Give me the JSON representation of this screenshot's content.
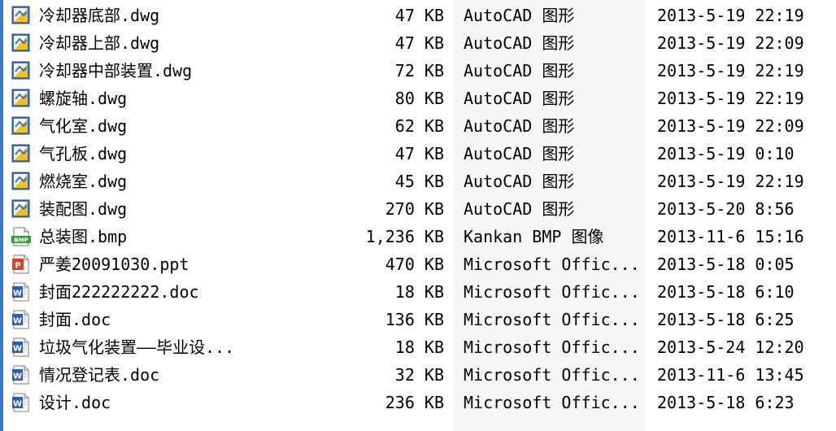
{
  "files": [
    {
      "name": "冷却器底部.dwg",
      "size": "47 KB",
      "type": "AutoCAD 图形",
      "date": "2013-5-19 22:19",
      "icon": "dwg-file-icon"
    },
    {
      "name": "冷却器上部.dwg",
      "size": "47 KB",
      "type": "AutoCAD 图形",
      "date": "2013-5-19 22:09",
      "icon": "dwg-file-icon"
    },
    {
      "name": "冷却器中部装置.dwg",
      "size": "72 KB",
      "type": "AutoCAD 图形",
      "date": "2013-5-19 22:19",
      "icon": "dwg-file-icon"
    },
    {
      "name": "螺旋轴.dwg",
      "size": "80 KB",
      "type": "AutoCAD 图形",
      "date": "2013-5-19 22:19",
      "icon": "dwg-file-icon"
    },
    {
      "name": "气化室.dwg",
      "size": "62 KB",
      "type": "AutoCAD 图形",
      "date": "2013-5-19 22:09",
      "icon": "dwg-file-icon"
    },
    {
      "name": "气孔板.dwg",
      "size": "47 KB",
      "type": "AutoCAD 图形",
      "date": "2013-5-19 0:10",
      "icon": "dwg-file-icon"
    },
    {
      "name": "燃烧室.dwg",
      "size": "45 KB",
      "type": "AutoCAD 图形",
      "date": "2013-5-19 22:19",
      "icon": "dwg-file-icon"
    },
    {
      "name": "装配图.dwg",
      "size": "270 KB",
      "type": "AutoCAD 图形",
      "date": "2013-5-20 8:56",
      "icon": "dwg-file-icon"
    },
    {
      "name": "总装图.bmp",
      "size": "1,236 KB",
      "type": "Kankan BMP 图像",
      "date": "2013-11-6 15:16",
      "icon": "bmp-file-icon"
    },
    {
      "name": "严姜20091030.ppt",
      "size": "470 KB",
      "type": "Microsoft Offic...",
      "date": "2013-5-18 0:05",
      "icon": "ppt-file-icon"
    },
    {
      "name": "封面222222222.doc",
      "size": "18 KB",
      "type": "Microsoft Offic...",
      "date": "2013-5-18 6:10",
      "icon": "doc-file-icon"
    },
    {
      "name": "封面.doc",
      "size": "136 KB",
      "type": "Microsoft Offic...",
      "date": "2013-5-18 6:25",
      "icon": "doc-file-icon"
    },
    {
      "name": "垃圾气化装置——毕业设...",
      "size": "18 KB",
      "type": "Microsoft Offic...",
      "date": "2013-5-24 12:20",
      "icon": "doc-file-icon"
    },
    {
      "name": "情况登记表.doc",
      "size": "32 KB",
      "type": "Microsoft Offic...",
      "date": "2013-11-6 13:45",
      "icon": "doc-file-icon"
    },
    {
      "name": "设计.doc",
      "size": "236 KB",
      "type": "Microsoft Offic...",
      "date": "2013-5-18 6:23",
      "icon": "doc-file-icon"
    }
  ],
  "colors": {
    "sorted_column_bg": "#f7f7f7",
    "dwg_icon_blue": "#3a6fc4",
    "dwg_icon_yellow": "#f2c21c",
    "bmp_icon_green": "#3a9a3a",
    "ppt_icon_red": "#d0452c",
    "doc_icon_blue": "#2b5fb4"
  }
}
